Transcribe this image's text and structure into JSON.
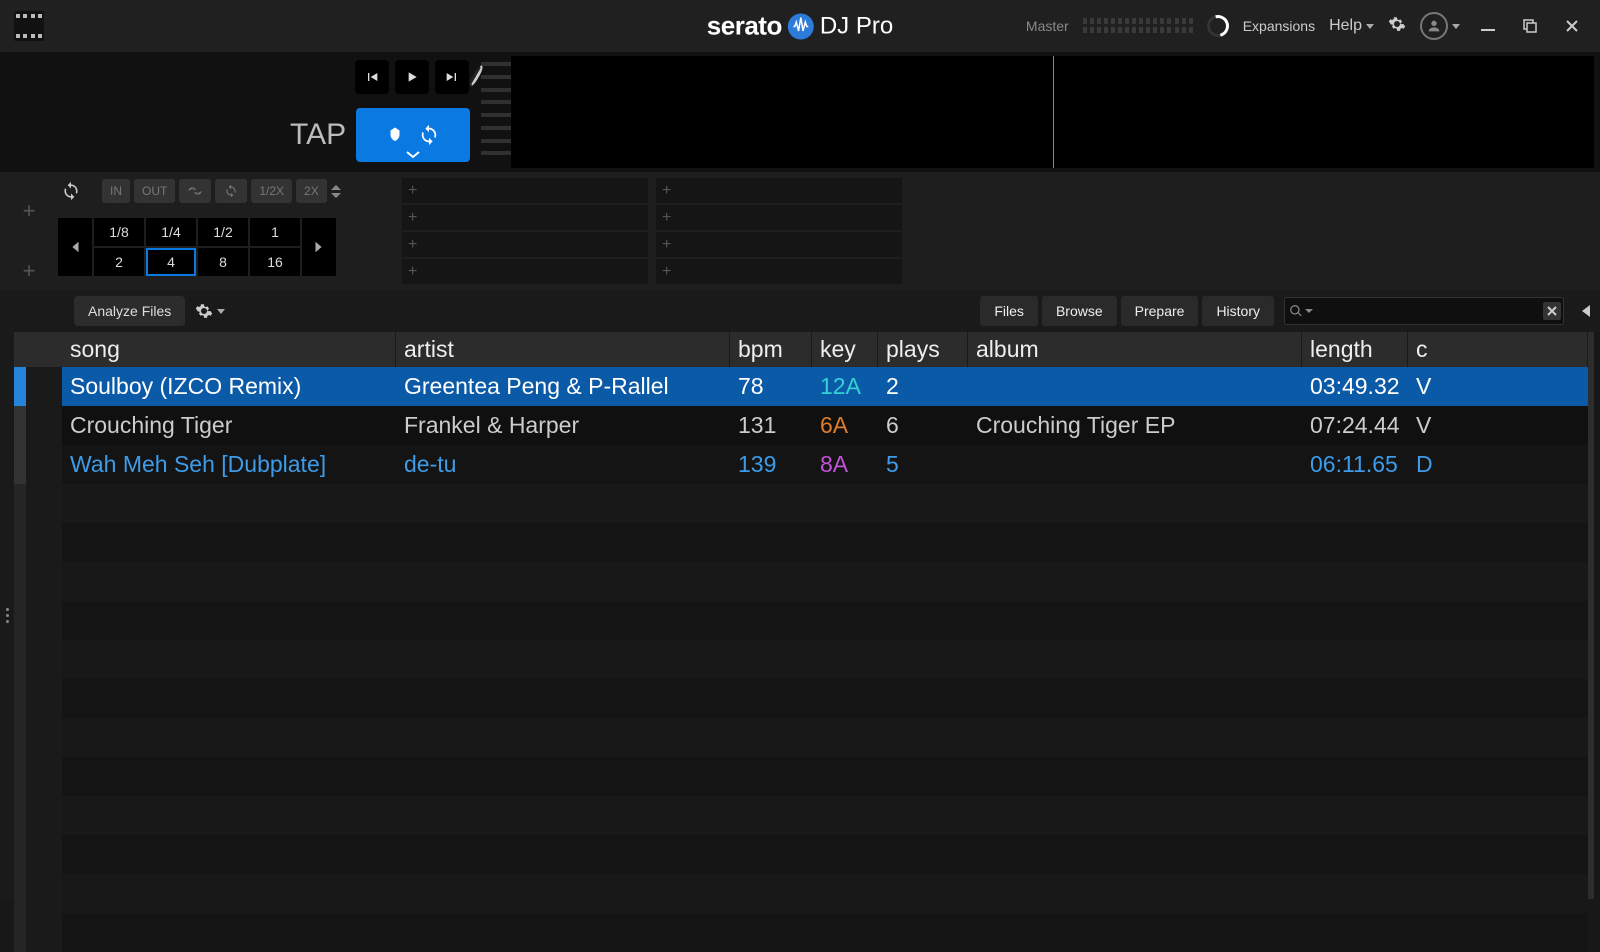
{
  "topbar": {
    "brand_bold": "serato",
    "brand_light": "DJ Pro",
    "master_label": "Master",
    "expansions": "Expansions",
    "help": "Help"
  },
  "deck": {
    "tap_label": "TAP"
  },
  "loop": {
    "in": "IN",
    "out": "OUT",
    "half": "1/2X",
    "dbl": "2X",
    "beats": [
      "1/8",
      "1/4",
      "1/2",
      "1",
      "2",
      "4",
      "8",
      "16"
    ],
    "active_beat": "4"
  },
  "library": {
    "analyze": "Analyze Files",
    "tabs": {
      "files": "Files",
      "browse": "Browse",
      "prepare": "Prepare",
      "history": "History"
    },
    "search_placeholder": ""
  },
  "columns": {
    "song": "song",
    "artist": "artist",
    "bpm": "bpm",
    "key": "key",
    "plays": "plays",
    "album": "album",
    "length": "length",
    "extra": "c"
  },
  "tracks": [
    {
      "song": "Soulboy (IZCO Remix)",
      "artist": "Greentea Peng & P-Rallel",
      "bpm": "78",
      "key": "12A",
      "key_class": "key-12a",
      "plays": "2",
      "album": "",
      "length": "03:49.32",
      "extra": "V",
      "selected": true,
      "playing": false
    },
    {
      "song": "Crouching Tiger",
      "artist": "Frankel & Harper",
      "bpm": "131",
      "key": "6A",
      "key_class": "key-6a",
      "plays": "6",
      "album": "Crouching Tiger EP",
      "length": "07:24.44",
      "extra": "V",
      "selected": false,
      "playing": false
    },
    {
      "song": "Wah Meh Seh [Dubplate]",
      "artist": "de-tu",
      "bpm": "139",
      "key": "8A",
      "key_class": "key-8a",
      "plays": "5",
      "album": "",
      "length": "06:11.65",
      "extra": "D",
      "selected": false,
      "playing": true
    }
  ]
}
